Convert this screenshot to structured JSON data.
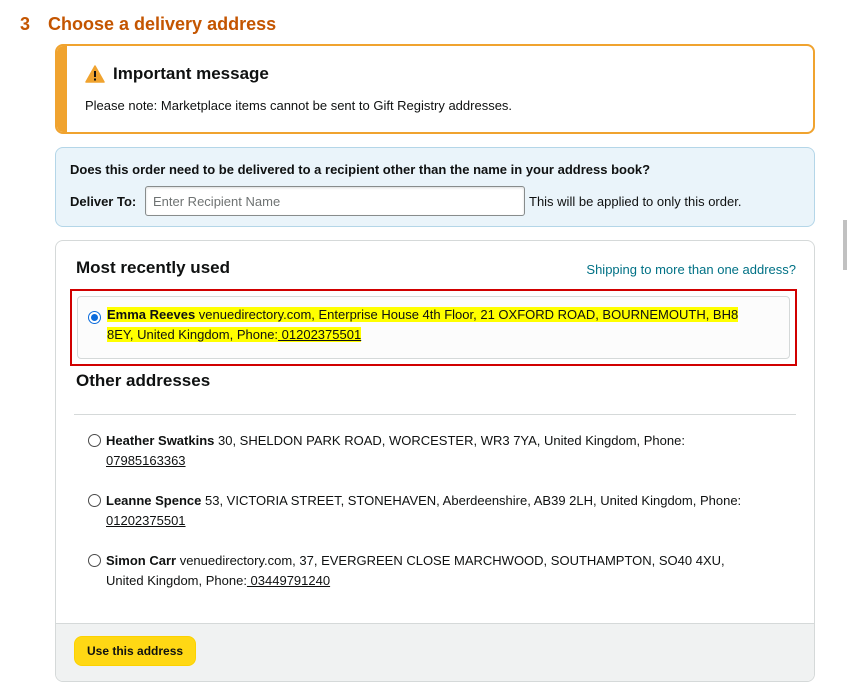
{
  "step": {
    "number": "3",
    "title": "Choose a delivery address"
  },
  "alert": {
    "icon": "warning-icon",
    "title": "Important message",
    "text": "Please note: Marketplace items cannot be sent to Gift Registry addresses."
  },
  "recipient": {
    "question": "Does this order need to be delivered to a recipient other than the name in your address book?",
    "label": "Deliver To:",
    "value": "",
    "placeholder": "Enter Recipient Name",
    "note": "This will be applied to only this order."
  },
  "addresses": {
    "recent_title": "Most recently used",
    "multi_link": "Shipping to more than one address?",
    "selected": {
      "name": "Emma Reeves",
      "line1_rest": "venuedirectory.com, Enterprise House 4th Floor, 21 OXFORD ROAD, BOURNEMOUTH, BH8",
      "line2": "8EY, United Kingdom, Phone:",
      "phone": " 01202375501"
    },
    "other_title": "Other addresses",
    "others": [
      {
        "name": "Heather Swatkins",
        "line1_rest": "30, SHELDON PARK ROAD, WORCESTER, WR3 7YA, United Kingdom, Phone:",
        "line2": "",
        "phone": "07985163363"
      },
      {
        "name": "Leanne Spence",
        "line1_rest": "53, VICTORIA STREET, STONEHAVEN, Aberdeenshire, AB39 2LH, United Kingdom, Phone:",
        "line2": "",
        "phone": "01202375501"
      },
      {
        "name": "Simon Carr",
        "line1_rest": "venuedirectory.com, 37, EVERGREEN CLOSE MARCHWOOD, SOUTHAMPTON, SO40 4XU,",
        "line2": "United Kingdom, Phone:",
        "phone": " 03449791240"
      }
    ]
  },
  "footer": {
    "button": "Use this address"
  },
  "colors": {
    "heading": "#c45500",
    "alert_border": "#f0a32f",
    "link": "#007185",
    "button": "#ffd814",
    "highlight": "#ffff00",
    "selection_outline": "#d10000"
  }
}
